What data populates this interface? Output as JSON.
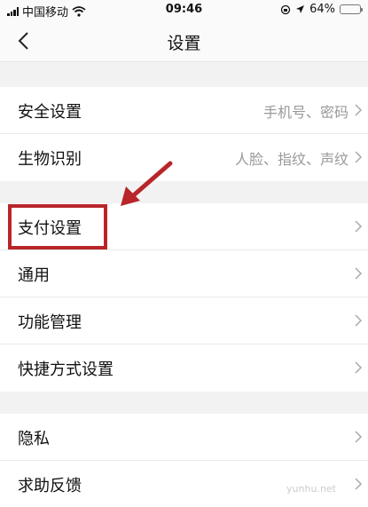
{
  "status": {
    "carrier": "中国移动",
    "time": "09:46",
    "battery": "64%",
    "battery_level": 0.64
  },
  "nav": {
    "title": "设置"
  },
  "groups": [
    {
      "items": [
        {
          "label": "安全设置",
          "value": "手机号、密码"
        },
        {
          "label": "生物识别",
          "value": "人脸、指纹、声纹"
        }
      ]
    },
    {
      "items": [
        {
          "label": "支付设置"
        },
        {
          "label": "通用"
        },
        {
          "label": "功能管理"
        },
        {
          "label": "快捷方式设置"
        }
      ]
    },
    {
      "items": [
        {
          "label": "隐私"
        },
        {
          "label": "求助反馈"
        }
      ]
    }
  ],
  "watermark": "yunhu.net",
  "colors": {
    "annotation": "#b8262a",
    "battery": "#f5c518"
  }
}
